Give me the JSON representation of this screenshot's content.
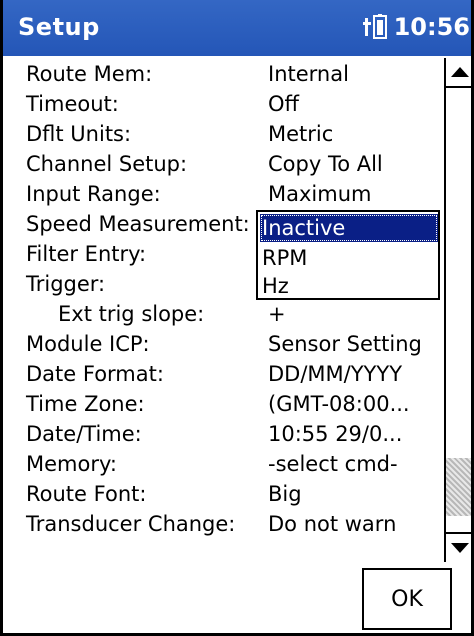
{
  "titlebar": {
    "title": "Setup",
    "clock": "10:56",
    "battery_icon": "battery-icon"
  },
  "rows": [
    {
      "label": "Route Mem:",
      "value": "Internal"
    },
    {
      "label": "Timeout:",
      "value": "Off"
    },
    {
      "label": "Dflt Units:",
      "value": "Metric"
    },
    {
      "label": "Channel Setup:",
      "value": "Copy To All"
    },
    {
      "label": "Input Range:",
      "value": "Maximum"
    },
    {
      "label": "Speed Measurement:",
      "value": ""
    },
    {
      "label": "Filter Entry:",
      "value": ""
    },
    {
      "label": "Trigger:",
      "value": ""
    },
    {
      "label": "Ext trig slope:",
      "value": "+"
    },
    {
      "label": "Module ICP:",
      "value": "Sensor Setting"
    },
    {
      "label": "Date Format:",
      "value": "DD/MM/YYYY"
    },
    {
      "label": "Time Zone:",
      "value": "(GMT-08:00..."
    },
    {
      "label": "Date/Time:",
      "value": "10:55 29/0..."
    },
    {
      "label": "Memory:",
      "value": "-select cmd-"
    },
    {
      "label": "Route Font:",
      "value": "Big"
    },
    {
      "label": "Transducer Change:",
      "value": "Do not warn"
    }
  ],
  "dropdown": {
    "selected": "Inactive",
    "options": [
      "Inactive",
      "RPM",
      "Hz"
    ]
  },
  "buttons": {
    "ok_label": "OK"
  },
  "scrollbar": {
    "up_icon": "arrow-up-icon",
    "down_icon": "arrow-down-icon"
  }
}
